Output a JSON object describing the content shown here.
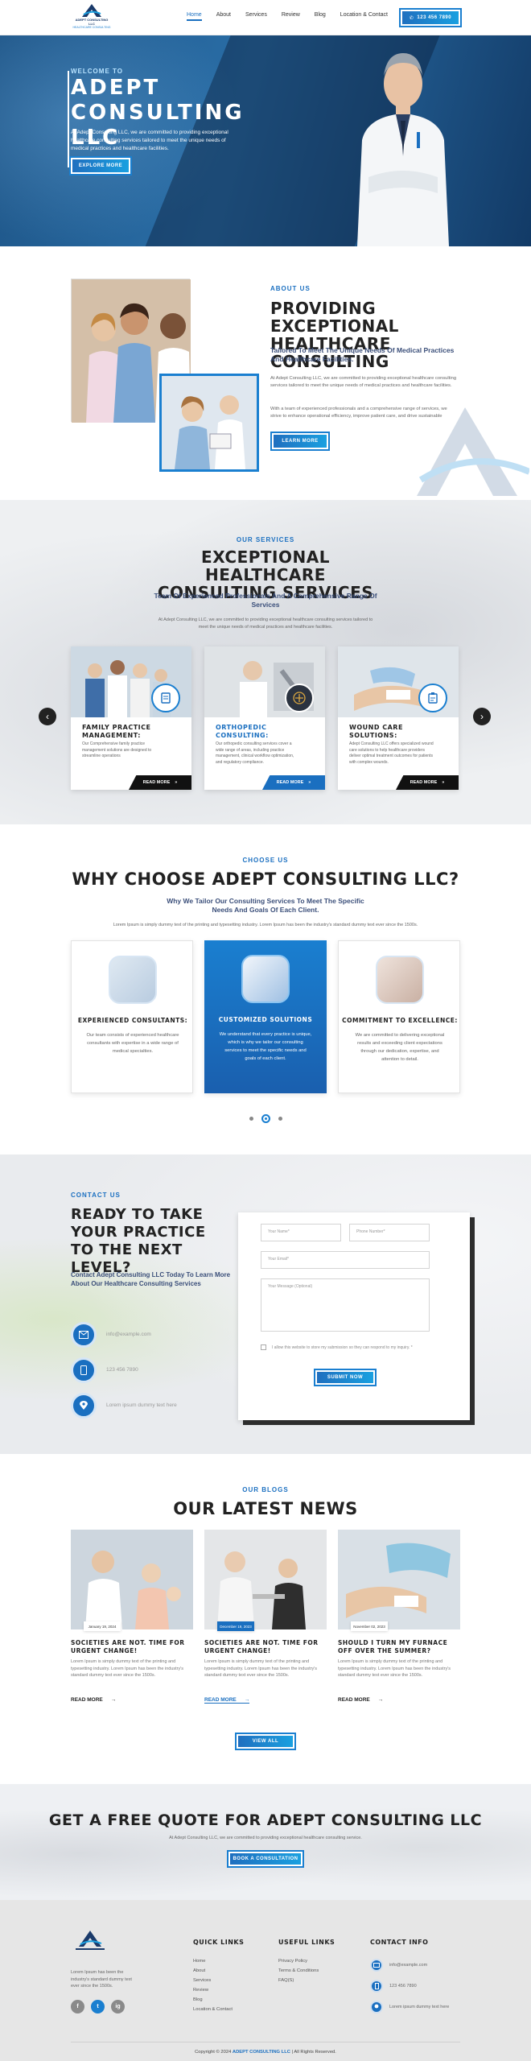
{
  "header": {
    "logo_name": "ADEPT CONSULTING LLC",
    "logo_tag": "HEALTHCARE CONSULTING",
    "nav": [
      "Home",
      "About",
      "Services",
      "Review",
      "Blog",
      "Location & Contact"
    ],
    "call_label": "123 456 7890"
  },
  "hero": {
    "kicker": "WELCOME TO",
    "title": "ADEPT CONSULTING LLC",
    "text": "At Adept Consulting LLC, we are committed to providing exceptional healthcare consulting services tailored to meet the unique needs of medical practices and healthcare facilities.",
    "button": "EXPLORE MORE"
  },
  "about": {
    "kicker": "ABOUT US",
    "title": "PROVIDING EXCEPTIONAL HEALTHCARE CONSULTING",
    "subtitle": "Tailored To Meet The Unique Needs Of Medical Practices And Healthcare Facilities.",
    "p1": "At Adept Consulting LLC, we are committed to providing exceptional healthcare consulting services tailored to meet the unique needs of medical practices and healthcare facilities.",
    "p2": "With a team of experienced professionals and a comprehensive range of services, we strive to enhance operational efficiency, improve patient care, and drive sustainable",
    "button": "LEARN MORE"
  },
  "services": {
    "kicker": "OUR SERVICES",
    "title": "EXCEPTIONAL HEALTHCARE CONSULTING SERVICES",
    "subtitle": "Team Of Experienced Professionals And A Comprehensive Range Of Services",
    "text": "At Adept Consulting LLC, we are committed to providing exceptional healthcare consulting services tailored to meet the unique needs of medical practices and healthcare facilities.",
    "cards": [
      {
        "title": "FAMILY PRACTICE MANAGEMENT:",
        "desc": "Our Comprehensive family practice management solutions are designed to streamline operations",
        "more": "READ MORE"
      },
      {
        "title": "ORTHOPEDIC CONSULTING:",
        "desc": "Our orthopedic consulting services cover a wide range of areas, including practice management, clinical workflow optimization, and regulatory compliance.",
        "more": "READ MORE"
      },
      {
        "title": "WOUND CARE SOLUTIONS:",
        "desc": "Adept Consulting LLC offers specialized wound care solutions to help healthcare providers deliver optimal treatment outcomes for patients with complex wounds.",
        "more": "READ MORE"
      }
    ],
    "prev": "‹",
    "next": "›"
  },
  "why": {
    "kicker": "CHOOSE US",
    "title": "WHY CHOOSE ADEPT CONSULTING LLC?",
    "subtitle": "Why We Tailor Our Consulting Services To Meet The Specific Needs And Goals Of Each Client.",
    "text": "Lorem Ipsum is simply dummy text of the printing and typesetting industry. Lorem Ipsum has been the industry's standard dummy text ever since the 1500s.",
    "cards": [
      {
        "title": "EXPERIENCED CONSULTANTS:",
        "desc": "Our team consists of experienced healthcare consultants with expertise in a wide range of medical specialties."
      },
      {
        "title": "CUSTOMIZED SOLUTIONS",
        "desc": "We understand that every practice is unique, which is why we tailor our consulting services to meet the specific needs and goals of each client."
      },
      {
        "title": "COMMITMENT TO EXCELLENCE:",
        "desc": "We are committed to delivering exceptional results and exceeding client expectations through our dedication, expertise, and attention to detail."
      }
    ]
  },
  "contact": {
    "kicker": "CONTACT US",
    "title": "READY TO TAKE YOUR PRACTICE TO THE NEXT LEVEL?",
    "subtitle": "Contact Adept Consulting LLC Today To Learn More About Our Healthcare Consulting Services",
    "email": "info@example.com",
    "phone": "123 456 7890",
    "address": "Lorem ipsum dummy text here",
    "form": {
      "name_ph": "Your Name*",
      "phone_ph": "Phone Number*",
      "email_ph": "Your Email*",
      "message_ph": "Your Message (Optional)",
      "consent": "I allow this website to store my submission so they can respond to my inquiry. *",
      "submit": "SUBMIT NOW"
    }
  },
  "blog": {
    "kicker": "OUR BLOGS",
    "title": "OUR LATEST NEWS",
    "posts": [
      {
        "date": "January 19, 2024",
        "title": "SOCIETIES ARE NOT. TIME FOR URGENT CHANGE!",
        "desc": "Lorem Ipsum is simply dummy text of the printing and typesetting industry. Lorem Ipsum has been the industry's standard dummy text ever since the 1500s.",
        "more": "READ MORE"
      },
      {
        "date": "December 19, 2023",
        "title": "SOCIETIES ARE NOT. TIME FOR URGENT CHANGE!",
        "desc": "Lorem Ipsum is simply dummy text of the printing and typesetting industry. Lorem Ipsum has been the industry's standard dummy text ever since the 1500s.",
        "more": "READ MORE"
      },
      {
        "date": "November 02, 2023",
        "title": "SHOULD I TURN MY FURNACE OFF OVER THE SUMMER?",
        "desc": "Lorem Ipsum is simply dummy text of the printing and typesetting industry. Lorem Ipsum has been the industry's standard dummy text ever since the 1500s.",
        "more": "READ MORE"
      }
    ],
    "view_all": "VIEW ALL"
  },
  "quote": {
    "title": "GET A FREE QUOTE FOR ADEPT CONSULTING LLC",
    "text": "At Adept Consulting LLC, we are committed to providing exceptional healthcare consulting service.",
    "button": "BOOK A CONSULTATION"
  },
  "footer": {
    "about": "Lorem Ipsum has been the industry's standard dummy text ever since the 1500s.",
    "social": [
      "f",
      "t",
      "ig"
    ],
    "quick_title": "QUICK LINKS",
    "quick_links": [
      "Home",
      "About",
      "Services",
      "Review",
      "Blog",
      "Location & Contact"
    ],
    "useful_title": "USEFUL LINKS",
    "useful_links": [
      "Privacy Policy",
      "Terms & Conditions",
      "FAQ(S)"
    ],
    "contact_title": "CONTACT INFO",
    "email": "info@example.com",
    "phone": "123 456 7890",
    "address": "Lorem ipsum dummy text here",
    "copyright_pre": "Copyright © 2024",
    "copyright_brand": "ADEPT CONSULTING LLC",
    "copyright_post": "| All Rights Reserved."
  },
  "colors": {
    "primary": "#1a6fc0",
    "accent": "#1aa0e0",
    "dark": "#222222"
  }
}
